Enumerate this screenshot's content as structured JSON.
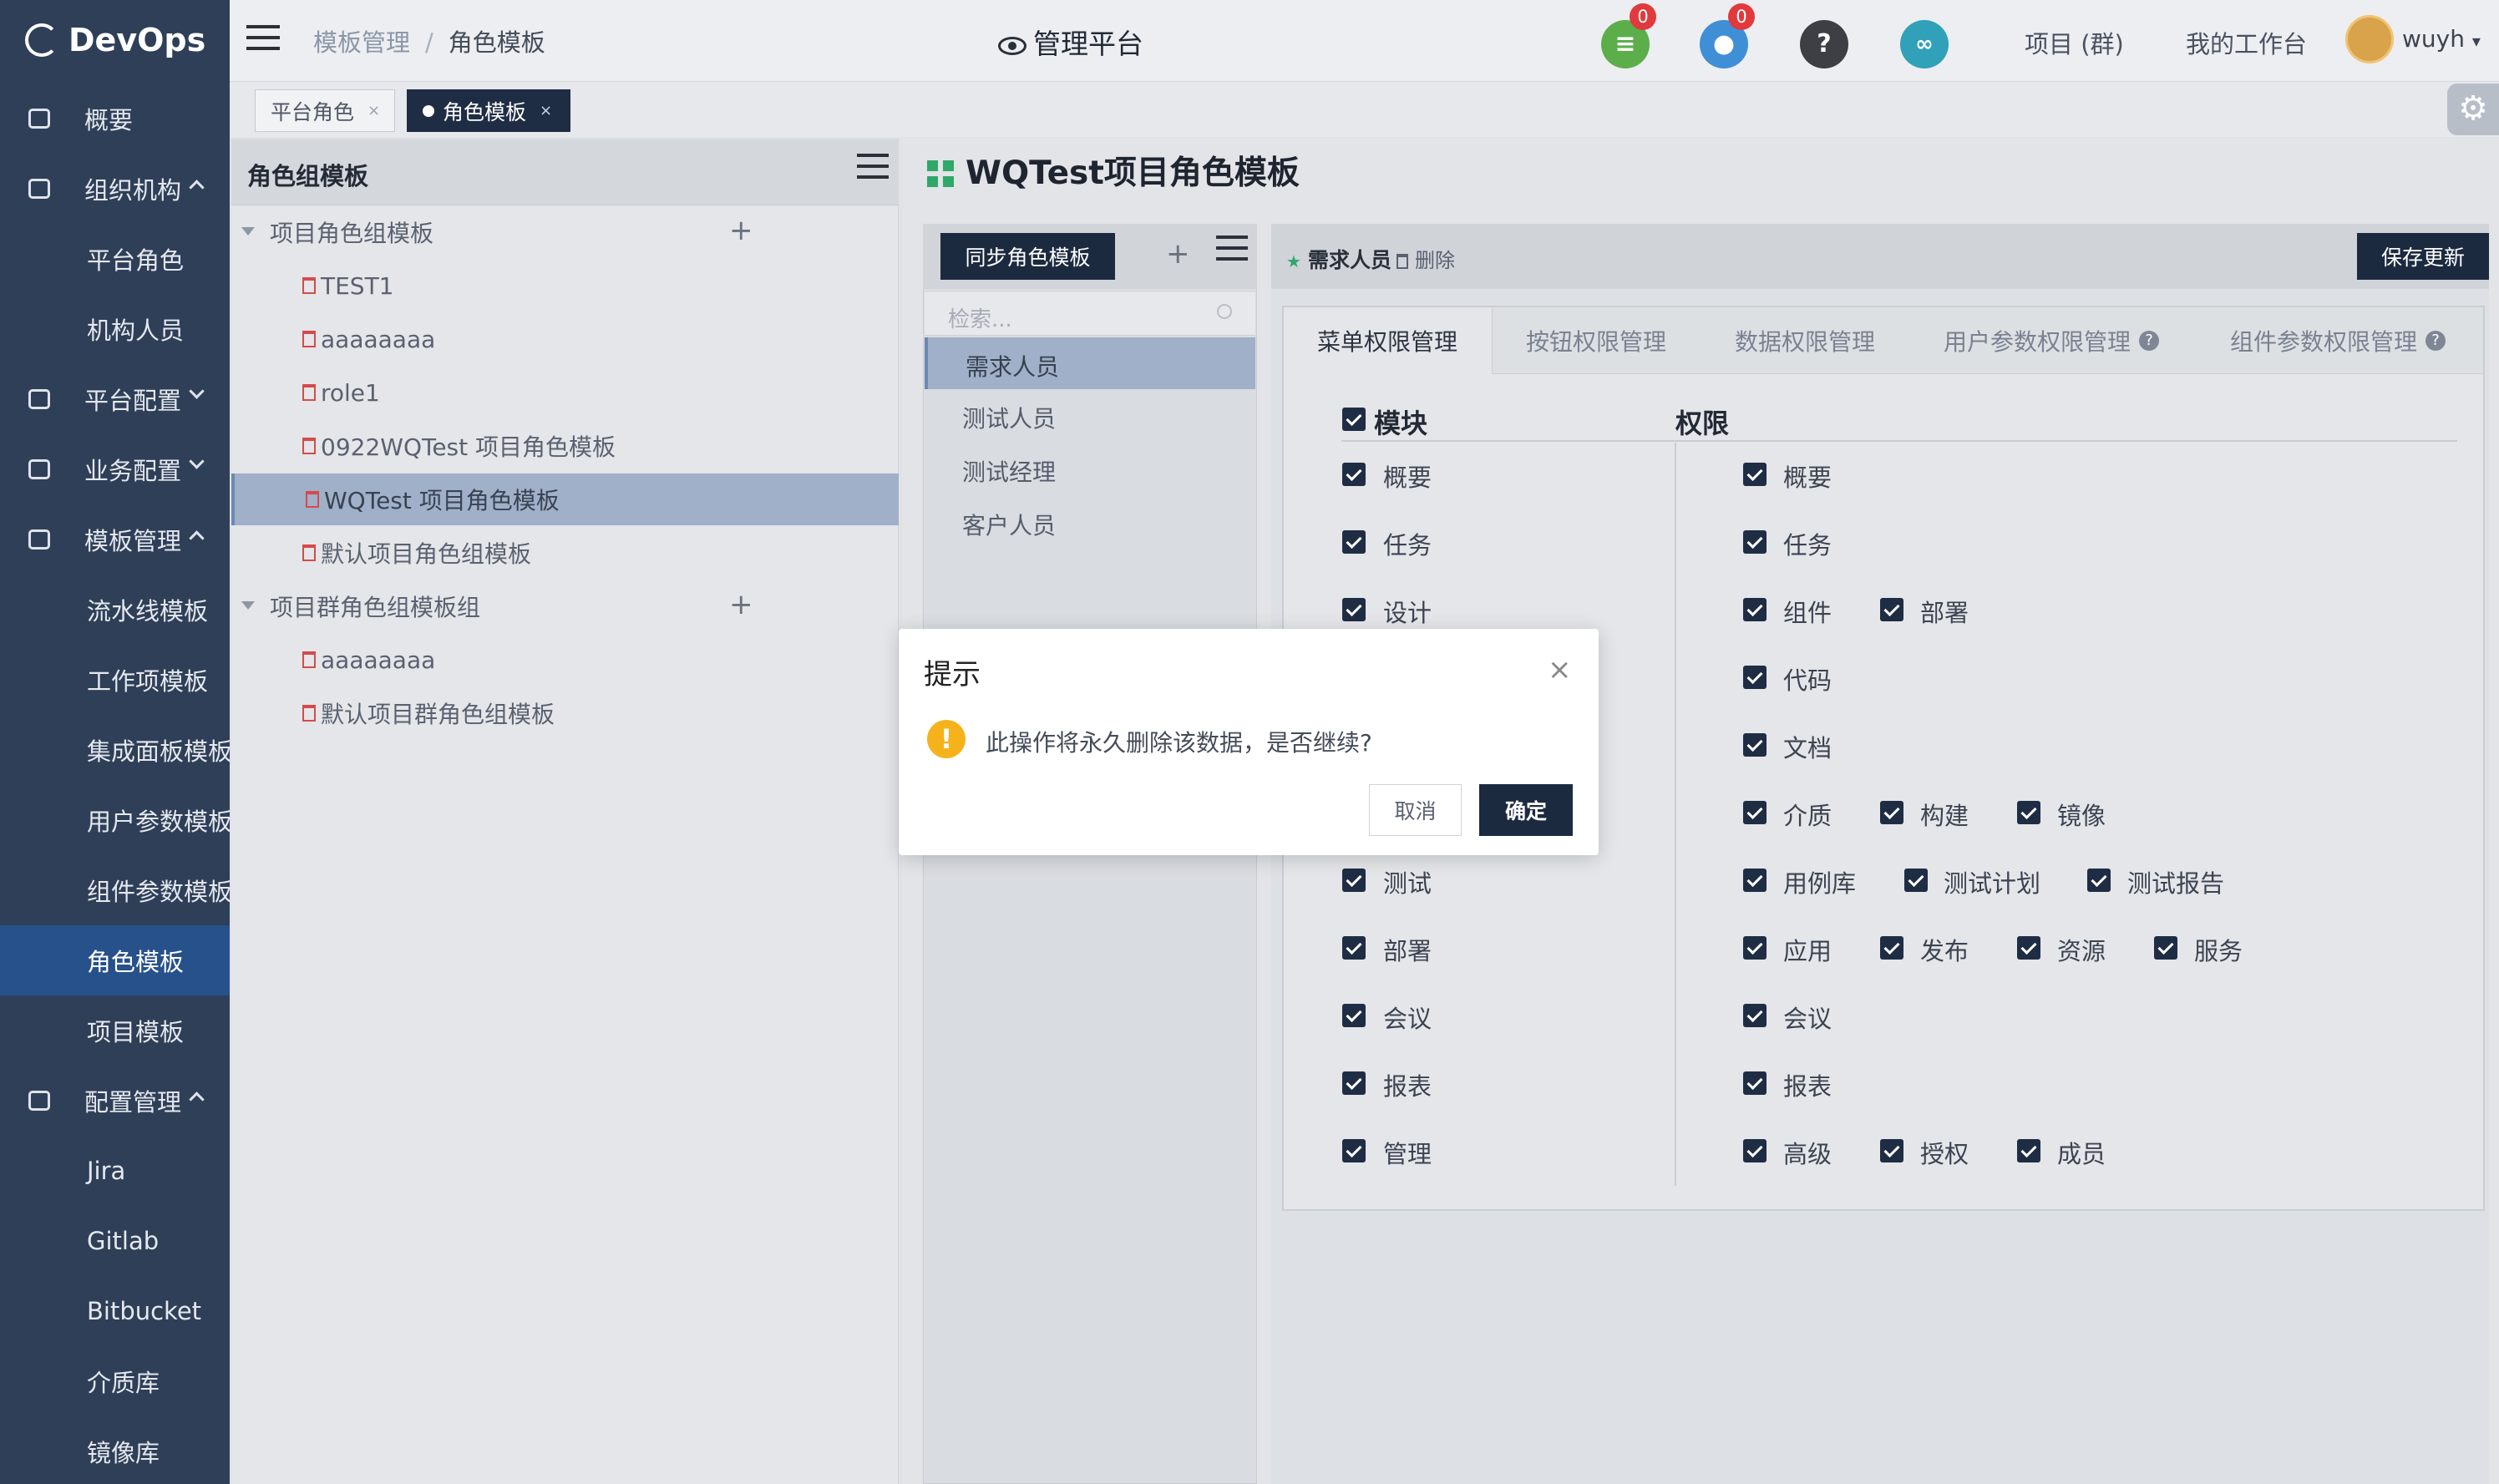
{
  "app": {
    "brand": "DevOps",
    "platform_title": "管理平台"
  },
  "sidebar": {
    "items": [
      {
        "label": "概要",
        "icon": "dashboard-icon"
      },
      {
        "label": "组织机构",
        "icon": "lock-icon"
      },
      {
        "label": "平台角色"
      },
      {
        "label": "机构人员"
      },
      {
        "label": "平台配置",
        "icon": "gear-icon"
      },
      {
        "label": "业务配置",
        "icon": "sliders-icon"
      },
      {
        "label": "模板管理",
        "icon": "template-icon"
      },
      {
        "label": "流水线模板"
      },
      {
        "label": "工作项模板"
      },
      {
        "label": "集成面板模板"
      },
      {
        "label": "用户参数模板"
      },
      {
        "label": "组件参数模板"
      },
      {
        "label": "角色模板"
      },
      {
        "label": "项目模板"
      },
      {
        "label": "配置管理",
        "icon": "database-icon"
      },
      {
        "label": "Jira"
      },
      {
        "label": "Gitlab"
      },
      {
        "label": "Bitbucket"
      },
      {
        "label": "介质库"
      },
      {
        "label": "镜像库"
      }
    ]
  },
  "header": {
    "breadcrumb": [
      "模板管理",
      "/",
      "角色模板"
    ],
    "badges": {
      "tasks": "0",
      "notifications": "0"
    },
    "help_glyph": "?",
    "links": [
      "项目 (群)",
      "我的工作台"
    ],
    "user": "wuyh"
  },
  "tabs": [
    {
      "label": "平台角色",
      "close": "×"
    },
    {
      "label": "角色模板",
      "close": "×"
    }
  ],
  "left_panel": {
    "title": "角色组模板",
    "groups": [
      {
        "label": "项目角色组模板",
        "children": [
          "TEST1",
          "aaaaaaaa",
          "role1",
          "0922WQTest 项目角色模板",
          "WQTest 项目角色模板",
          "默认项目角色组模板"
        ]
      },
      {
        "label": "项目群角色组模板组",
        "children": [
          "aaaaaaaa",
          "默认项目群角色组模板"
        ]
      }
    ],
    "plus_glyph": "+"
  },
  "main": {
    "title": "WQTest项目角色模板",
    "sync_button": "同步角色模板",
    "search_placeholder": "检索...",
    "roles": [
      "需求人员",
      "测试人员",
      "测试经理",
      "客户人员"
    ],
    "selected_role": "需求人员",
    "delete_label": "删除",
    "save_button": "保存更新",
    "perm_tabs": [
      "菜单权限管理",
      "按钮权限管理",
      "数据权限管理",
      "用户参数权限管理",
      "组件参数权限管理"
    ],
    "col_module": "模块",
    "col_perm": "权限",
    "modules": [
      "概要",
      "任务",
      "设计",
      "测试",
      "部署",
      "会议",
      "报表",
      "管理"
    ],
    "permissions": [
      [
        "概要"
      ],
      [
        "任务"
      ],
      [
        "组件",
        "部署"
      ],
      [
        "代码"
      ],
      [
        "文档"
      ],
      [
        "介质",
        "构建",
        "镜像"
      ],
      [
        "用例库",
        "测试计划",
        "测试报告"
      ],
      [
        "应用",
        "发布",
        "资源",
        "服务"
      ],
      [
        "会议"
      ],
      [
        "报表"
      ],
      [
        "高级",
        "授权",
        "成员"
      ]
    ]
  },
  "modal": {
    "title": "提示",
    "message": "此操作将永久删除该数据，是否继续?",
    "cancel": "取消",
    "confirm": "确定",
    "close_glyph": "×",
    "warn_glyph": "!"
  },
  "colors": {
    "sidebar": "#2f3f58",
    "active": "#27518a",
    "primary": "#1c2a40",
    "accent_green": "#2fa86a",
    "warn": "#f6b21b"
  }
}
